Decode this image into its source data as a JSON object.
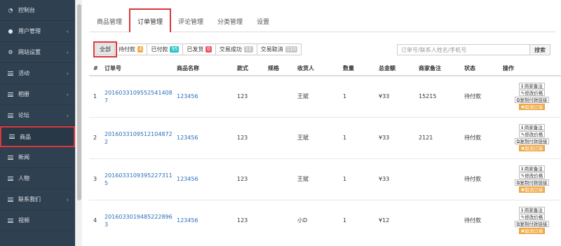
{
  "sidebar": {
    "items": [
      {
        "label": "控制台",
        "icon": "dashboard-icon",
        "chevron": false
      },
      {
        "label": "用户管理",
        "icon": "users-icon",
        "chevron": true
      },
      {
        "label": "网站设置",
        "icon": "cogs-icon",
        "chevron": true
      },
      {
        "label": "活动",
        "icon": "list-icon",
        "chevron": true
      },
      {
        "label": "相册",
        "icon": "list-icon",
        "chevron": true
      },
      {
        "label": "论坛",
        "icon": "list-icon",
        "chevron": true
      },
      {
        "label": "商品",
        "icon": "list-icon",
        "chevron": false,
        "active": true
      },
      {
        "label": "新闻",
        "icon": "list-icon",
        "chevron": false
      },
      {
        "label": "人物",
        "icon": "list-icon",
        "chevron": false
      },
      {
        "label": "联系我们",
        "icon": "list-icon",
        "chevron": true
      },
      {
        "label": "视频",
        "icon": "list-icon",
        "chevron": false
      }
    ]
  },
  "tabs": [
    {
      "label": "商品管理"
    },
    {
      "label": "订单管理",
      "active": true
    },
    {
      "label": "评论管理"
    },
    {
      "label": "分类管理"
    },
    {
      "label": "设置"
    }
  ],
  "filters": [
    {
      "label": "全部",
      "active": true
    },
    {
      "label": "待付款",
      "count": "4",
      "color": "#f0ad4e"
    },
    {
      "label": "已付款",
      "count": "95",
      "color": "#23c6c8"
    },
    {
      "label": "已发货",
      "count": "0",
      "color": "#ed5565"
    },
    {
      "label": "交易成功",
      "count": "11",
      "color": "#c8c8c8"
    },
    {
      "label": "交易取消",
      "count": "110",
      "color": "#c8c8c8"
    }
  ],
  "search": {
    "placeholder": "订单号/联系人姓名/手机号",
    "button": "搜索"
  },
  "table": {
    "headers": [
      "#",
      "订单号",
      "商品名称",
      "款式",
      "规格",
      "收货人",
      "数量",
      "总金额",
      "商家备注",
      "状态",
      "操作"
    ],
    "actions": [
      "商家备注",
      "修改价格",
      "复制付款链接",
      "取消订单"
    ],
    "rows": [
      {
        "idx": "1",
        "order": "2016033109552541408 7",
        "product": "123456",
        "style": "123",
        "spec": "",
        "receiver": "王斌",
        "qty": "1",
        "total": "¥33",
        "note": "15215",
        "status": "待付款"
      },
      {
        "idx": "2",
        "order": "2016033109512104872 2",
        "product": "123456",
        "style": "123",
        "spec": "",
        "receiver": "王斌",
        "qty": "1",
        "total": "¥33",
        "note": "2121",
        "status": "待付款"
      },
      {
        "idx": "3",
        "order": "2016033109395227311 5",
        "product": "123456",
        "style": "123",
        "spec": "",
        "receiver": "王斌",
        "qty": "1",
        "total": "¥33",
        "note": "",
        "status": "待付款"
      },
      {
        "idx": "4",
        "order": "2016033019485222896 3",
        "product": "123456",
        "style": "123",
        "spec": "",
        "receiver": "小D",
        "qty": "1",
        "total": "¥12",
        "note": "",
        "status": "待付款"
      }
    ]
  }
}
